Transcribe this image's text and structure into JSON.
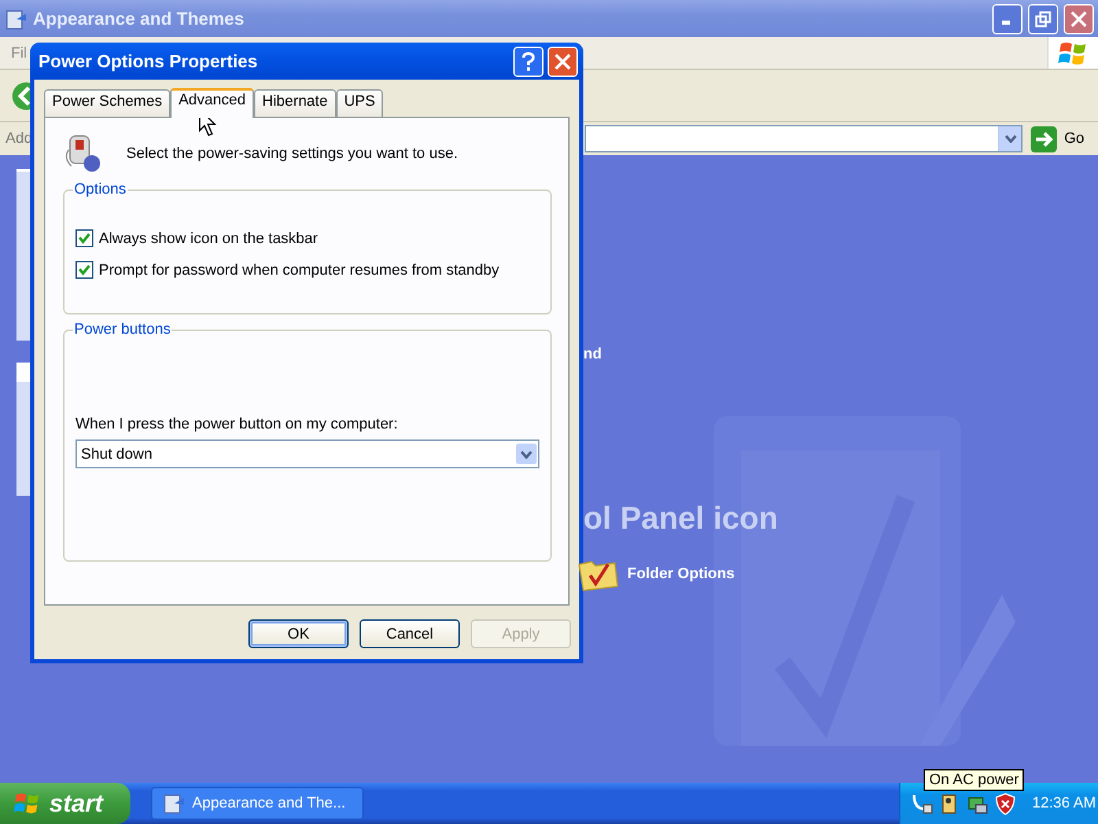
{
  "background_window": {
    "title": "Appearance and Themes",
    "menu": [
      "Fil"
    ],
    "address_label": "Add",
    "go_button": "Go",
    "content": {
      "fragment": "nd",
      "heading": "ol Panel icon",
      "links": [
        {
          "label": "Folder Options"
        }
      ]
    }
  },
  "dialog": {
    "title": "Power Options Properties",
    "tabs": [
      {
        "label": "Power Schemes",
        "selected": false
      },
      {
        "label": "Advanced",
        "selected": true
      },
      {
        "label": "Hibernate",
        "selected": false
      },
      {
        "label": "UPS",
        "selected": false
      }
    ],
    "intro": "Select the power-saving settings you want to use.",
    "options": {
      "title": "Options",
      "checkboxes": [
        {
          "label": "Always show icon on the taskbar",
          "checked": true
        },
        {
          "label": "Prompt for password when computer resumes from standby",
          "checked": true
        }
      ]
    },
    "power_buttons": {
      "title": "Power buttons",
      "prompt": "When I press the power button on my computer:",
      "dropdown": {
        "value": "Shut down"
      }
    },
    "buttons": [
      {
        "label": "OK",
        "default": true,
        "disabled": false
      },
      {
        "label": "Cancel",
        "default": false,
        "disabled": false
      },
      {
        "label": "Apply",
        "default": false,
        "disabled": true
      }
    ]
  },
  "taskbar": {
    "start": "start",
    "tasks": [
      {
        "label": "Appearance and The...",
        "selected": false
      }
    ],
    "tooltip": "On AC power",
    "clock": "12:36 AM"
  }
}
